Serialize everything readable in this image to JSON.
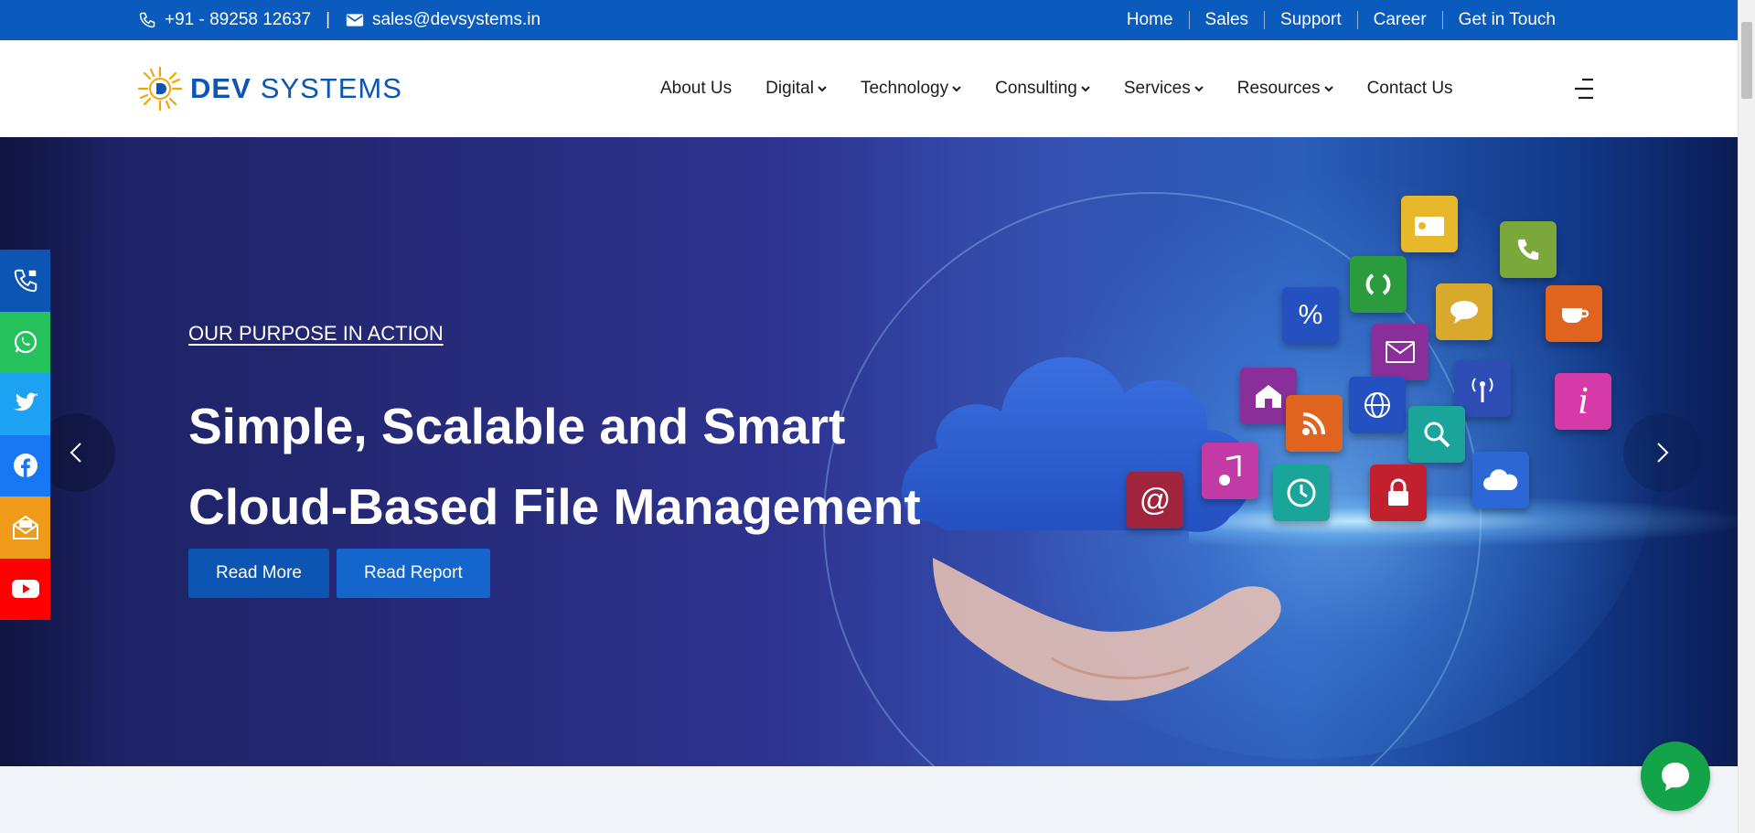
{
  "topbar": {
    "phone": "+91 - 89258 12637",
    "separator": "|",
    "email": "sales@devsystems.in",
    "links": [
      "Home",
      "Sales",
      "Support",
      "Career",
      "Get in Touch"
    ]
  },
  "header": {
    "logo_primary": "DEV",
    "logo_secondary": "SYSTEMS",
    "nav": {
      "about": "About Us",
      "digital": "Digital",
      "technology": "Technology",
      "consulting": "Consulting",
      "services": "Services",
      "resources": "Resources",
      "contact": "Contact Us"
    }
  },
  "hero": {
    "eyebrow": "OUR PURPOSE IN ACTION",
    "title_line1": "Simple, Scalable and Smart",
    "title_line2": "Cloud-Based File Management",
    "read_more": "Read More",
    "read_report": "Read Report"
  },
  "tiles": {
    "percent": "%",
    "email_at": "@",
    "info": "i"
  },
  "social": [
    {
      "name": "phone",
      "color": "#0c55b3"
    },
    {
      "name": "whatsapp",
      "color": "#25c15c"
    },
    {
      "name": "twitter",
      "color": "#1da1f2"
    },
    {
      "name": "facebook",
      "color": "#1877f2"
    },
    {
      "name": "mail",
      "color": "#f09a1a"
    },
    {
      "name": "youtube",
      "color": "#ff0000"
    }
  ],
  "colors": {
    "brand_blue": "#0a5bbd",
    "chat_green": "#13a44a"
  }
}
